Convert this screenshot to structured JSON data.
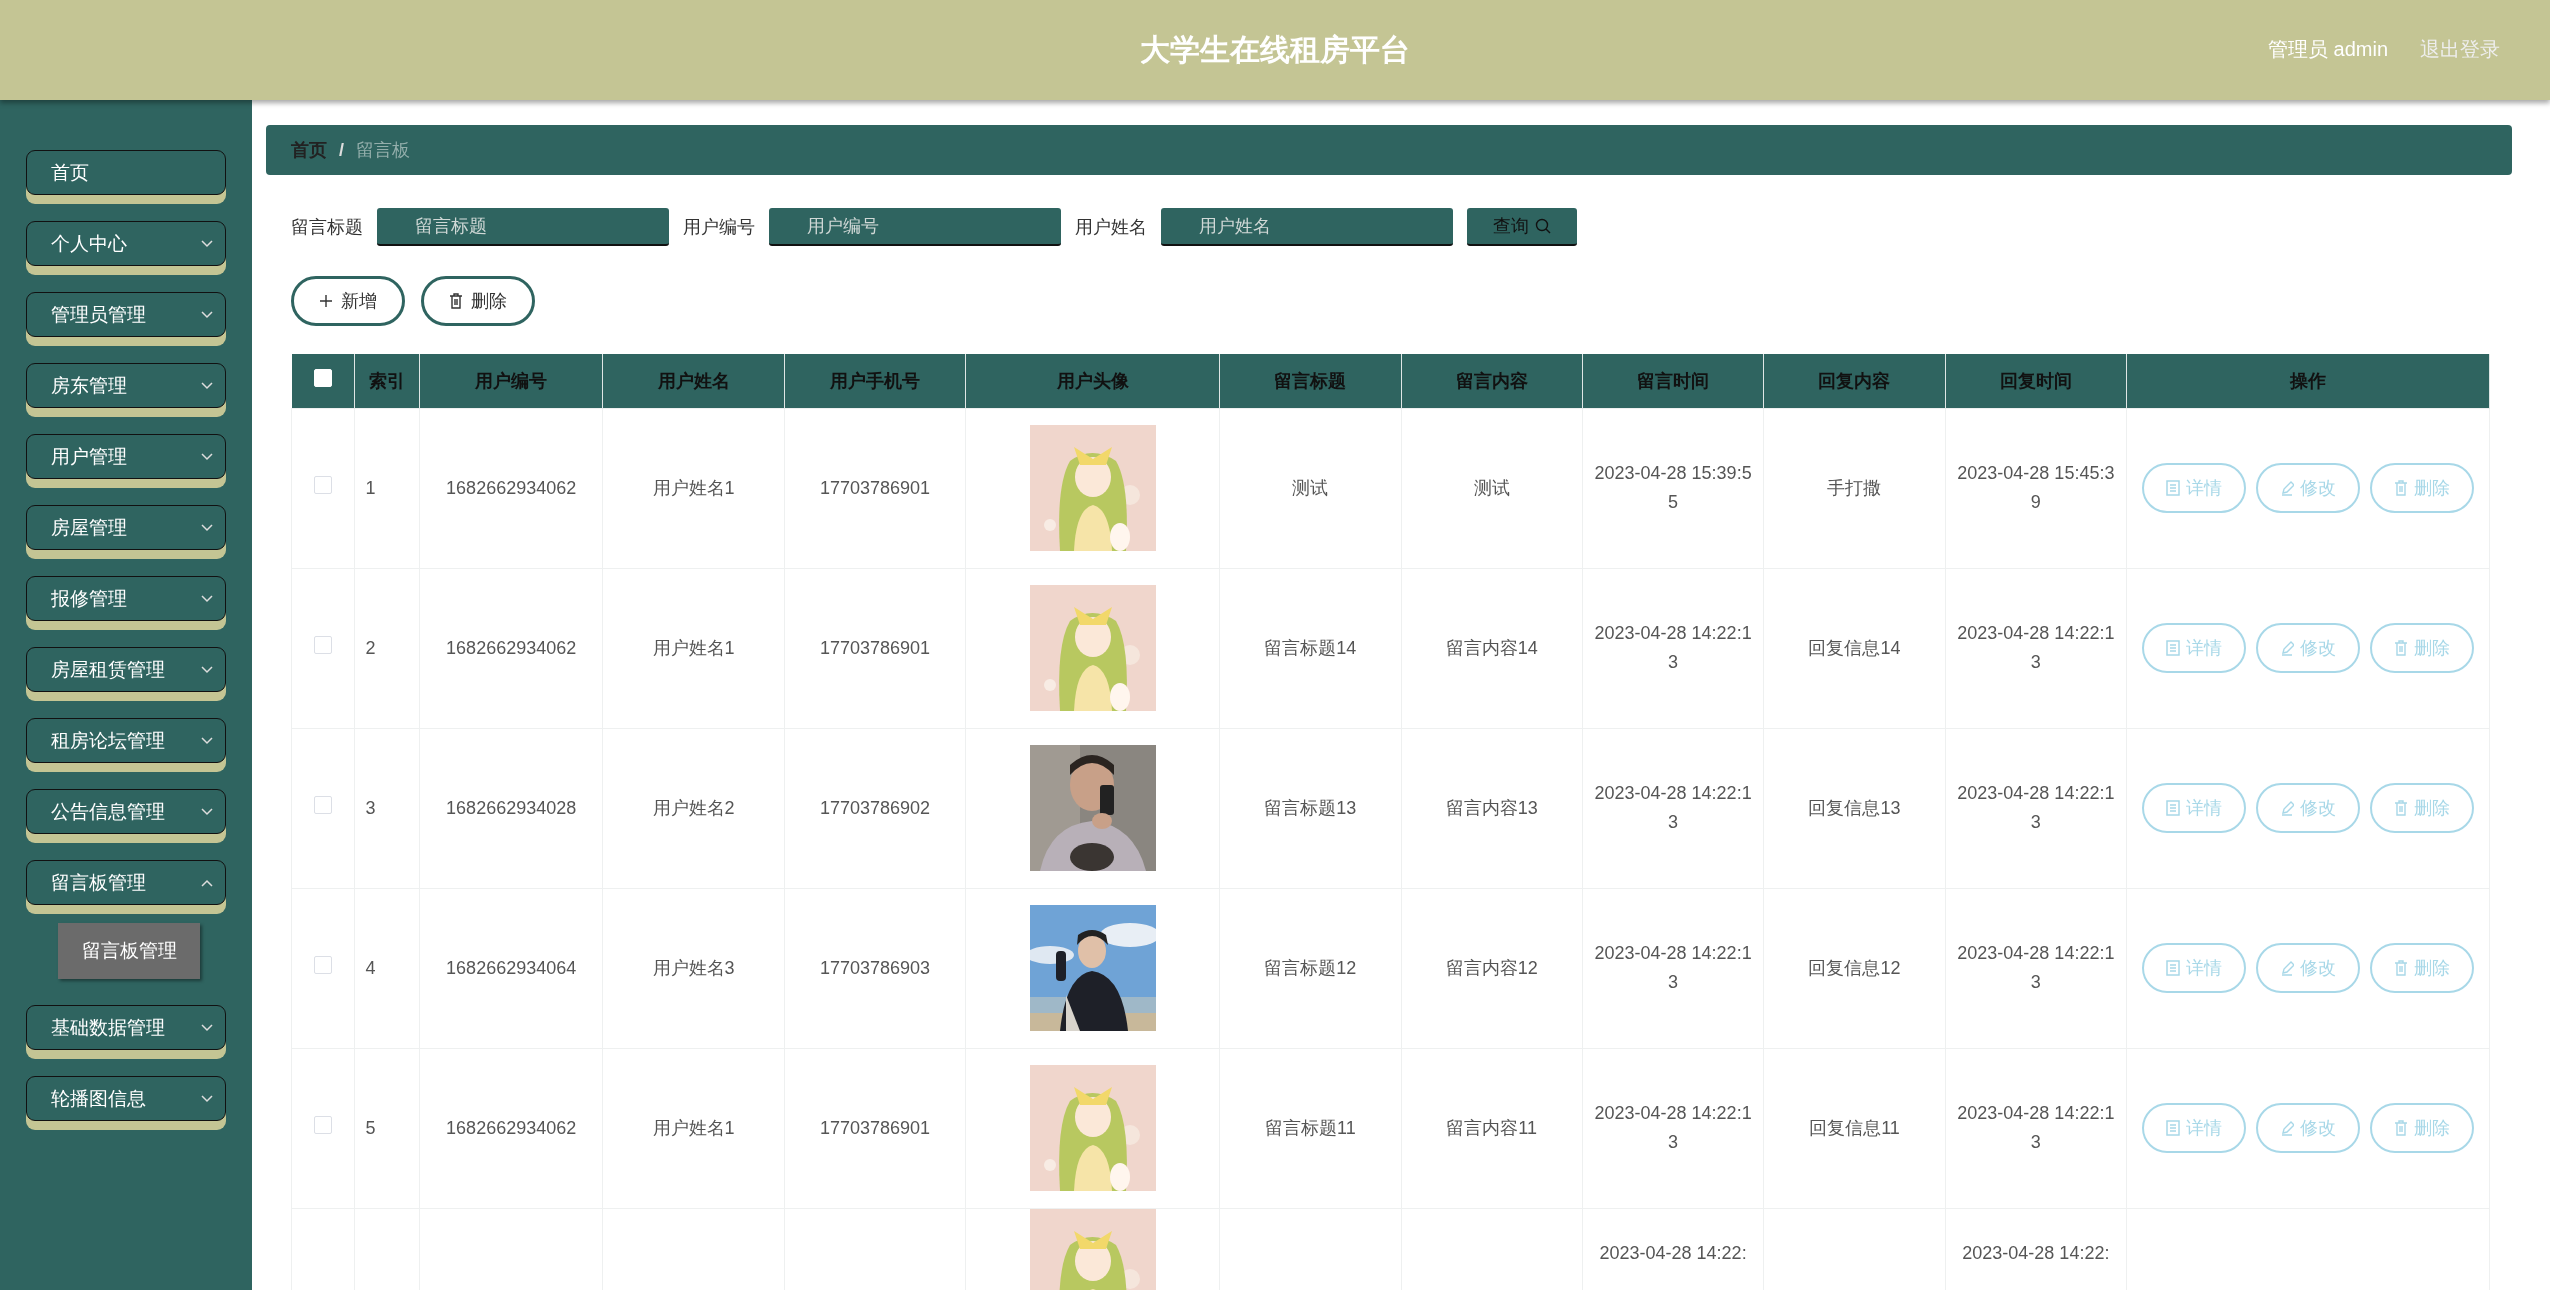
{
  "header": {
    "title": "大学生在线租房平台",
    "user": "管理员 admin",
    "logout": "退出登录"
  },
  "sidebar": {
    "items": [
      {
        "label": "首页",
        "kind": "link"
      },
      {
        "label": "个人中心",
        "kind": "menu",
        "expanded": false
      },
      {
        "label": "管理员管理",
        "kind": "menu",
        "expanded": false
      },
      {
        "label": "房东管理",
        "kind": "menu",
        "expanded": false
      },
      {
        "label": "用户管理",
        "kind": "menu",
        "expanded": false
      },
      {
        "label": "房屋管理",
        "kind": "menu",
        "expanded": false
      },
      {
        "label": "报修管理",
        "kind": "menu",
        "expanded": false
      },
      {
        "label": "房屋租赁管理",
        "kind": "menu",
        "expanded": false
      },
      {
        "label": "租房论坛管理",
        "kind": "menu",
        "expanded": false
      },
      {
        "label": "公告信息管理",
        "kind": "menu",
        "expanded": false
      },
      {
        "label": "留言板管理",
        "kind": "menu",
        "expanded": true,
        "children": [
          {
            "label": "留言板管理"
          }
        ]
      },
      {
        "label": "基础数据管理",
        "kind": "menu",
        "expanded": false
      },
      {
        "label": "轮播图信息",
        "kind": "menu",
        "expanded": false
      }
    ]
  },
  "breadcrumb": {
    "items": [
      "首页",
      "留言板"
    ],
    "separator": "/"
  },
  "search": {
    "fields": [
      {
        "label": "留言标题",
        "placeholder": "留言标题"
      },
      {
        "label": "用户编号",
        "placeholder": "用户编号"
      },
      {
        "label": "用户姓名",
        "placeholder": "用户姓名"
      }
    ],
    "button": "查询"
  },
  "actions": [
    "新增",
    "删除"
  ],
  "table": {
    "columns": [
      "索引",
      "用户编号",
      "用户姓名",
      "用户手机号",
      "用户头像",
      "留言标题",
      "留言内容",
      "留言时间",
      "回复内容",
      "回复时间",
      "操作"
    ],
    "header_checked": false,
    "rows": [
      {
        "checked": false,
        "cells": [
          "1",
          "1682662934062",
          "用户姓名1",
          "17703786901",
          null,
          "测试",
          "测试",
          "2023-04-28 15:39:55",
          "手打撒",
          "2023-04-28 15:45:39"
        ],
        "avatar": {
          "kind": "picture"
        },
        "actions": [
          "详情",
          "修改",
          "删除"
        ]
      },
      {
        "checked": false,
        "cells": [
          "2",
          "1682662934062",
          "用户姓名1",
          "17703786901",
          null,
          "留言标题14",
          "留言内容14",
          "2023-04-28 14:22:13",
          "回复信息14",
          "2023-04-28 14:22:13"
        ],
        "avatar": {
          "kind": "picture"
        },
        "actions": [
          "详情",
          "修改",
          "删除"
        ]
      },
      {
        "checked": false,
        "cells": [
          "3",
          "1682662934028",
          "用户姓名2",
          "17703786902",
          null,
          "留言标题13",
          "留言内容13",
          "2023-04-28 14:22:13",
          "回复信息13",
          "2023-04-28 14:22:13"
        ],
        "avatar": {
          "kind": "picture"
        },
        "actions": [
          "详情",
          "修改",
          "删除"
        ]
      },
      {
        "checked": false,
        "cells": [
          "4",
          "1682662934064",
          "用户姓名3",
          "17703786903",
          null,
          "留言标题12",
          "留言内容12",
          "2023-04-28 14:22:13",
          "回复信息12",
          "2023-04-28 14:22:13"
        ],
        "avatar": {
          "kind": "picture"
        },
        "actions": [
          "详情",
          "修改",
          "删除"
        ]
      },
      {
        "checked": false,
        "cells": [
          "5",
          "1682662934062",
          "用户姓名1",
          "17703786901",
          null,
          "留言标题11",
          "留言内容11",
          "2023-04-28 14:22:13",
          "回复信息11",
          "2023-04-28 14:22:13"
        ],
        "avatar": {
          "kind": "picture"
        },
        "actions": [
          "详情",
          "修改",
          "删除"
        ]
      }
    ],
    "partial_row": {
      "message_time": "2023-04-28 14:22:",
      "reply_time": "2023-04-28 14:22:",
      "avatar": {
        "kind": "picture"
      }
    }
  }
}
